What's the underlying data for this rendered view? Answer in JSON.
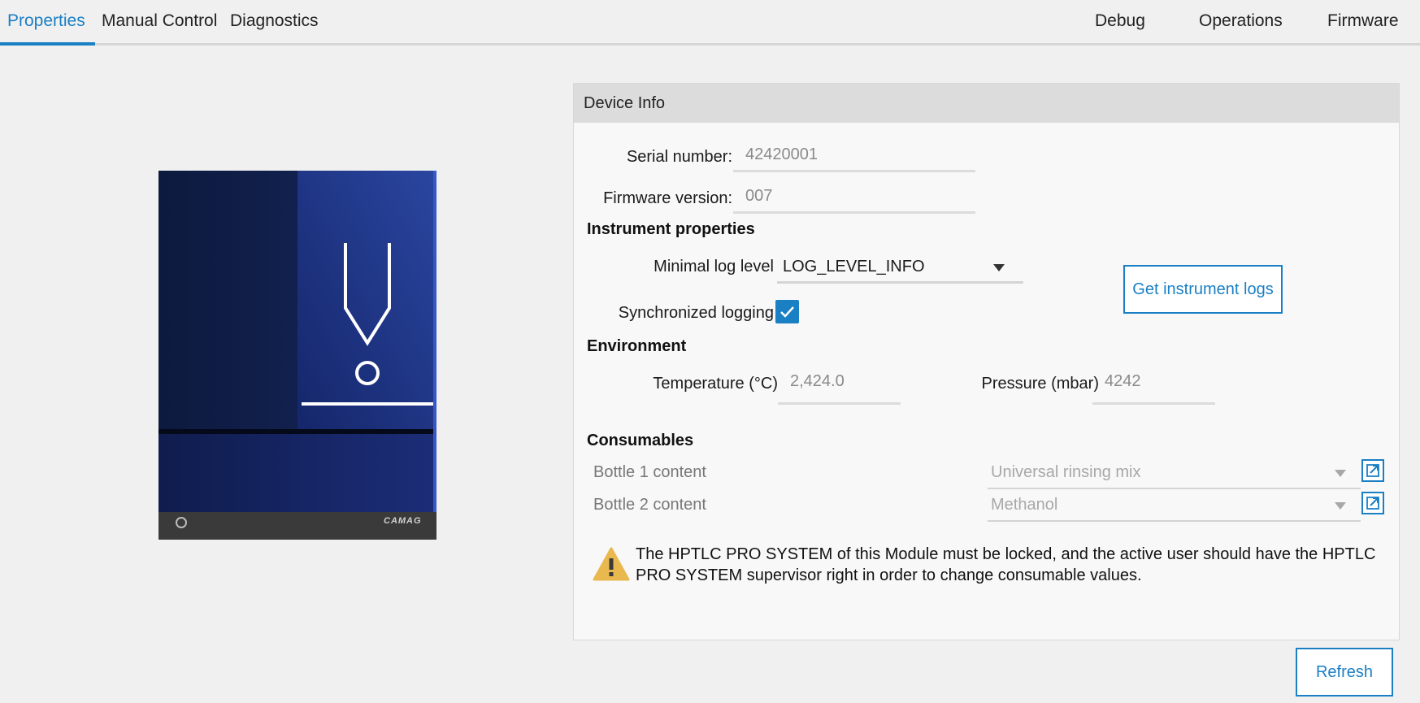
{
  "tabs": {
    "properties": "Properties",
    "manual_control": "Manual Control",
    "diagnostics": "Diagnostics",
    "debug": "Debug",
    "operations": "Operations",
    "firmware": "Firmware"
  },
  "device_info": {
    "title": "Device Info",
    "serial_label": "Serial number:",
    "serial_value": "42420001",
    "firmware_label": "Firmware version:",
    "firmware_value": "007"
  },
  "instrument": {
    "section": "Instrument properties",
    "log_level_label": "Minimal log level",
    "log_level_value": "LOG_LEVEL_INFO",
    "sync_label": "Synchronized logging",
    "sync_checked": true,
    "get_logs_button": "Get instrument logs"
  },
  "environment": {
    "section": "Environment",
    "temperature_label": "Temperature (°C)",
    "temperature_value": "2,424.0",
    "pressure_label": "Pressure (mbar)",
    "pressure_value": "4242"
  },
  "consumables": {
    "section": "Consumables",
    "bottle1_label": "Bottle 1 content",
    "bottle1_value": "Universal rinsing mix",
    "bottle2_label": "Bottle 2 content",
    "bottle2_value": "Methanol",
    "warning": "The HPTLC PRO SYSTEM of this Module must be locked, and the active user should have the HPTLC PRO SYSTEM supervisor right in order to change consumable values."
  },
  "device_brand": "CAMAG",
  "refresh_button": "Refresh",
  "colors": {
    "accent": "#1b7fc4",
    "device_blue": "#1a2a7a",
    "warning": "#e9b84f"
  }
}
